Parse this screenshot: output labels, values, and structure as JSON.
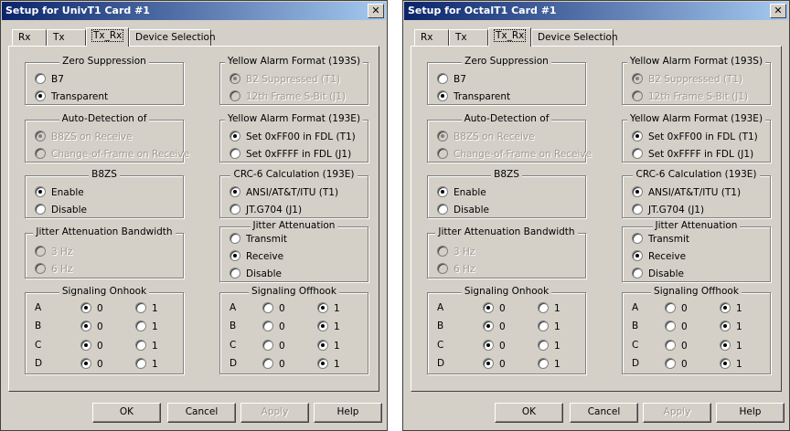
{
  "dialogs": [
    {
      "title": "Setup for UnivT1 Card #1",
      "bg": "#d4d0c8",
      "titlebar_color": "#0a246a",
      "tabs": [
        "Rx",
        "Tx",
        "Tx_Rx",
        "Device Selection"
      ],
      "active_tab": "Tx_Rx",
      "zero_suppression": {
        "title": "Zero Suppression",
        "opt1": "B7",
        "opt2": "Transparent",
        "selected": 2
      },
      "auto_detection": {
        "title": "Auto-Detection of",
        "opt1": "B8ZS on Receive",
        "opt2": "Change-of-Frame on Receive",
        "selected": 1
      },
      "b8zs": {
        "title": "B8ZS",
        "opt1": "Enable",
        "opt2": "Disable",
        "selected": 1
      },
      "jitter_bw": {
        "title": "Jitter Attenuation Bandwidth",
        "opt1": "3 Hz",
        "opt2": "6 Hz",
        "selected": 0
      },
      "yellow_193s": {
        "title": "Yellow Alarm Format (193S)",
        "opt1": "B2 Suppressed (T1)",
        "opt2": "12th Frame S-Bit (J1)",
        "selected": 1
      },
      "yellow_193e": {
        "title": "Yellow Alarm Format (193E)",
        "opt1": "Set 0xFF00 in FDL (T1)",
        "opt2": "Set 0xFFFF in FDL (J1)",
        "selected": 1
      },
      "crc6": {
        "title": "CRC-6 Calculation (193E)",
        "opt1": "ANSI/AT&T/ITU (T1)",
        "opt2": "JT.G704 (J1)",
        "selected": 1
      },
      "jitter_att": {
        "title": "Jitter Attenuation",
        "opt1": "Transmit",
        "opt2": "Receive",
        "opt3": "Disable",
        "selected": 2
      },
      "sig_onhook": {
        "title": "Signaling Onhook",
        "rows": [
          {
            "label": "A",
            "v0": "0",
            "v1": "1",
            "sel": 0
          },
          {
            "label": "B",
            "v0": "0",
            "v1": "1",
            "sel": 0
          },
          {
            "label": "C",
            "v0": "0",
            "v1": "1",
            "sel": 0
          },
          {
            "label": "D",
            "v0": "0",
            "v1": "1",
            "sel": 0
          }
        ]
      },
      "sig_offhook": {
        "title": "Signaling Offhook",
        "rows": [
          {
            "label": "A",
            "v0": "0",
            "v1": "1",
            "sel": 1
          },
          {
            "label": "B",
            "v0": "0",
            "v1": "1",
            "sel": 1
          },
          {
            "label": "C",
            "v0": "0",
            "v1": "1",
            "sel": 1
          },
          {
            "label": "D",
            "v0": "0",
            "v1": "1",
            "sel": 1
          }
        ]
      },
      "buttons": {
        "ok": "OK",
        "cancel": "Cancel",
        "apply": "Apply",
        "help": "Help"
      }
    },
    {
      "title": "Setup for OctalT1 Card #1",
      "bg": "#d4d0c8",
      "titlebar_color": "#0a246a",
      "tabs": [
        "Rx",
        "Tx",
        "Tx_Rx",
        "Device Selection"
      ],
      "active_tab": "Tx_Rx",
      "zero_suppression": {
        "title": "Zero Suppression",
        "opt1": "B7",
        "opt2": "Transparent",
        "selected": 2
      },
      "auto_detection": {
        "title": "Auto-Detection of",
        "opt1": "B8ZS on Receive",
        "opt2": "Change-of-Frame on Receive",
        "selected": 1
      },
      "b8zs": {
        "title": "B8ZS",
        "opt1": "Enable",
        "opt2": "Disable",
        "selected": 1
      },
      "jitter_bw": {
        "title": "Jitter Attenuation Bandwidth",
        "opt1": "3 Hz",
        "opt2": "6 Hz",
        "selected": 0
      },
      "yellow_193s": {
        "title": "Yellow Alarm Format (193S)",
        "opt1": "B2 Suppressed (T1)",
        "opt2": "12th Frame S-Bit (J1)",
        "selected": 1
      },
      "yellow_193e": {
        "title": "Yellow Alarm Format (193E)",
        "opt1": "Set 0xFF00 in FDL (T1)",
        "opt2": "Set 0xFFFF in FDL (J1)",
        "selected": 1
      },
      "crc6": {
        "title": "CRC-6 Calculation (193E)",
        "opt1": "ANSI/AT&T/ITU (T1)",
        "opt2": "JT.G704 (J1)",
        "selected": 1
      },
      "jitter_att": {
        "title": "Jitter Attenuation",
        "opt1": "Transmit",
        "opt2": "Receive",
        "opt3": "Disable",
        "selected": 2
      },
      "sig_onhook": {
        "title": "Signaling Onhook",
        "rows": [
          {
            "label": "A",
            "v0": "0",
            "v1": "1",
            "sel": 0
          },
          {
            "label": "B",
            "v0": "0",
            "v1": "1",
            "sel": 0
          },
          {
            "label": "C",
            "v0": "0",
            "v1": "1",
            "sel": 0
          },
          {
            "label": "D",
            "v0": "0",
            "v1": "1",
            "sel": 0
          }
        ]
      },
      "sig_offhook": {
        "title": "Signaling Offhook",
        "rows": [
          {
            "label": "A",
            "v0": "0",
            "v1": "1",
            "sel": 1
          },
          {
            "label": "B",
            "v0": "0",
            "v1": "1",
            "sel": 1
          },
          {
            "label": "C",
            "v0": "0",
            "v1": "1",
            "sel": 1
          },
          {
            "label": "D",
            "v0": "0",
            "v1": "1",
            "sel": 1
          }
        ]
      },
      "buttons": {
        "ok": "OK",
        "cancel": "Cancel",
        "apply": "Apply",
        "help": "Help"
      }
    }
  ]
}
